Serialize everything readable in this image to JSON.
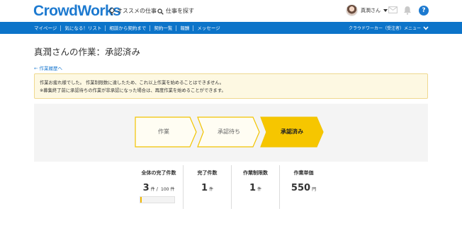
{
  "header": {
    "logo": "CrowdWorks",
    "recommend_label": "オススメの仕事",
    "search_label": "仕事を探す",
    "user_name": "真潤さん",
    "help_label": "?"
  },
  "nav": {
    "items": [
      {
        "label": "マイページ"
      },
      {
        "label": "気になる！リスト"
      },
      {
        "label": "相談から契約まで"
      },
      {
        "label": "契約一覧"
      },
      {
        "label": "報酬"
      },
      {
        "label": "メッセージ"
      }
    ],
    "menu_label": "クラウドワーカー（受注者）メニュー"
  },
  "page": {
    "title": "真潤さんの作業：承認済み",
    "back_link": "← 作業履歴へ"
  },
  "notice": {
    "line1": "作業お疲れ様でした。 作業制限数に達したため、これ以上作業を始めることはできません。",
    "line2": "※募集終了前に承認待ちの作業が非承認になった場合は、再度作業を始めることができます。"
  },
  "steps": [
    {
      "label": "作業",
      "state": "done"
    },
    {
      "label": "承認待ち",
      "state": "done"
    },
    {
      "label": "承認済み",
      "state": "current"
    }
  ],
  "colors": {
    "brand_blue": "#1d7ad0",
    "nav_blue": "#0c74c9",
    "step_yellow": "#f6c600",
    "step_border": "#f2c400",
    "step_done_bg": "#fffdf3"
  },
  "stats": {
    "total": {
      "label": "全体の完了件数",
      "value": "3",
      "unit": "件",
      "separator": "/",
      "max": "100 件",
      "progress": 0.03
    },
    "completed": {
      "label": "完了件数",
      "value": "1",
      "unit": "件"
    },
    "limit": {
      "label": "作業制限数",
      "value": "1",
      "unit": "件"
    },
    "price": {
      "label": "作業単価",
      "value": "550",
      "unit": "円"
    }
  }
}
